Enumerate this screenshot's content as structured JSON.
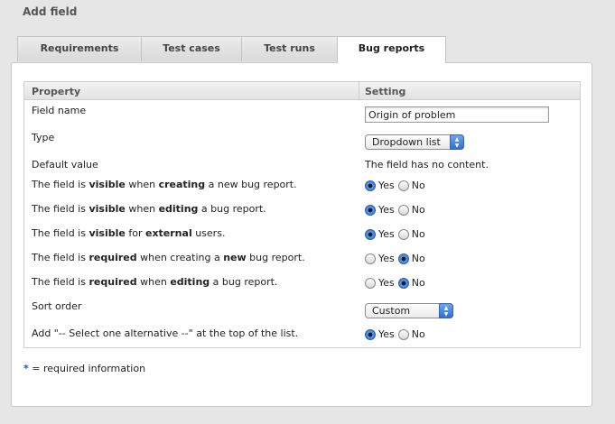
{
  "page": {
    "title": "Add field"
  },
  "tabs": [
    {
      "label": "Requirements",
      "active": false
    },
    {
      "label": "Test cases",
      "active": false
    },
    {
      "label": "Test runs",
      "active": false
    },
    {
      "label": "Bug reports",
      "active": true
    }
  ],
  "table": {
    "headers": {
      "property": "Property",
      "setting": "Setting"
    },
    "field_name": {
      "label": "Field name",
      "value": "Origin of problem"
    },
    "type": {
      "label": "Type",
      "value": "Dropdown list"
    },
    "default_value": {
      "label": "Default value",
      "value": "The field has no content."
    },
    "visible_creating": {
      "pre": "The field is ",
      "b1": "visible",
      "mid": " when ",
      "b2": "creating",
      "post": " a new bug report.",
      "yes": "Yes",
      "no": "No",
      "selected": "yes"
    },
    "visible_editing": {
      "pre": "The field is ",
      "b1": "visible",
      "mid": " when ",
      "b2": "editing",
      "post": " a bug report.",
      "yes": "Yes",
      "no": "No",
      "selected": "yes"
    },
    "visible_external": {
      "pre": "The field is ",
      "b1": "visible",
      "mid": " for ",
      "b2": "external",
      "post": " users.",
      "yes": "Yes",
      "no": "No",
      "selected": "yes"
    },
    "required_creating": {
      "pre": "The field is ",
      "b1": "required",
      "mid": " when creating a ",
      "b2": "new",
      "post": " bug report.",
      "yes": "Yes",
      "no": "No",
      "selected": "no"
    },
    "required_editing": {
      "pre": "The field is ",
      "b1": "required",
      "mid": " when ",
      "b2": "editing",
      "post": " a bug report.",
      "yes": "Yes",
      "no": "No",
      "selected": "no"
    },
    "sort_order": {
      "label": "Sort order",
      "value": "Custom"
    },
    "add_select_one": {
      "label": "Add \"-- Select one alternative --\" at the top of the list.",
      "yes": "Yes",
      "no": "No",
      "selected": "yes"
    }
  },
  "footnote": {
    "star": "*",
    "text": " = required information"
  },
  "colors": {
    "required_star": "#1a4fd6",
    "radio_selected": "#2b6fd1",
    "select_arrow": "#2f6fd3"
  }
}
